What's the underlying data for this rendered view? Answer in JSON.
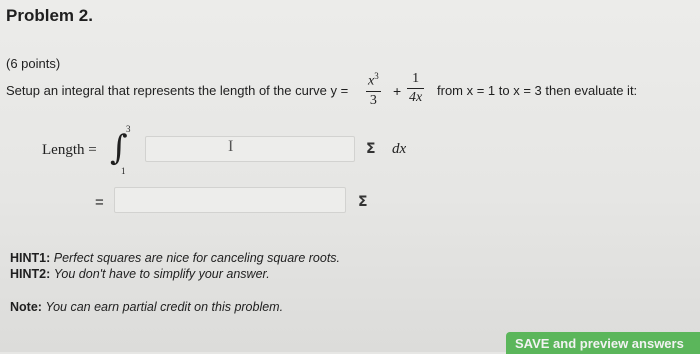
{
  "problem": {
    "title": "Problem 2.",
    "points": "(6 points)",
    "prompt_before": "Setup an integral that represents the length of the curve",
    "curve_lhs": "y =",
    "term1_num": "x",
    "term1_exp": "3",
    "term1_den": "3",
    "plus": "+",
    "term2_num": "1",
    "term2_den": "4x",
    "prompt_after": "from x = 1 to x = 3 then evaluate it:"
  },
  "integral": {
    "label": "Length =",
    "symbol": "∫",
    "upper": "3",
    "lower": "1",
    "differential": "dx",
    "second_equals": "=",
    "input1_value": "",
    "input2_value": "",
    "sigma_symbol": "Σ"
  },
  "hints": {
    "hint1_label": "HINT1:",
    "hint1_text": "Perfect squares are nice for canceling square roots.",
    "hint2_label": "HINT2:",
    "hint2_text": "You don't have to simplify your answer.",
    "note_label": "Note:",
    "note_text": "You can earn partial credit on this problem."
  },
  "actions": {
    "save_label": "SAVE and preview answers"
  },
  "colors": {
    "button_green": "#5bb65b"
  }
}
